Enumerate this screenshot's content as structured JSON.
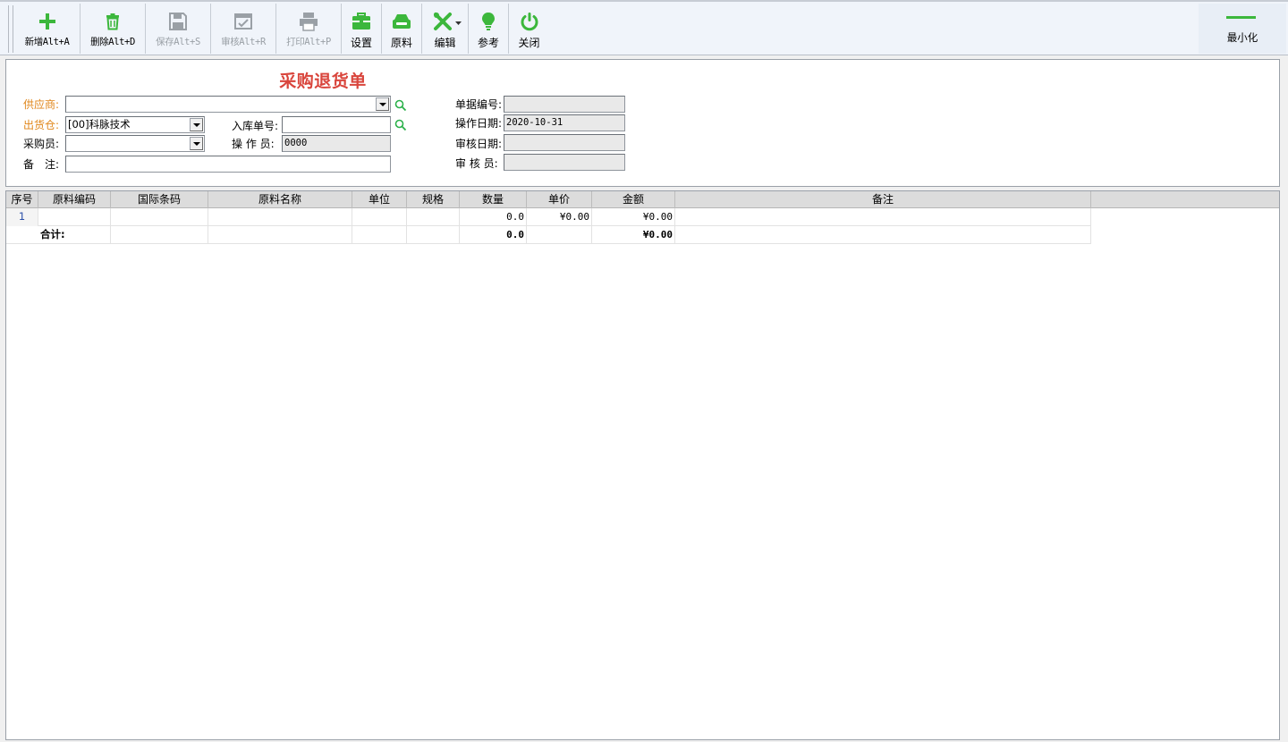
{
  "toolbar": {
    "buttons": [
      {
        "id": "add",
        "label": "新增Alt+A",
        "enabled": true
      },
      {
        "id": "delete",
        "label": "删除Alt+D",
        "enabled": true
      },
      {
        "id": "save",
        "label": "保存Alt+S",
        "enabled": false
      },
      {
        "id": "audit",
        "label": "审核Alt+R",
        "enabled": false
      },
      {
        "id": "print",
        "label": "打印Alt+P",
        "enabled": false
      },
      {
        "id": "settings",
        "label": "设置",
        "enabled": true
      },
      {
        "id": "material",
        "label": "原料",
        "enabled": true
      },
      {
        "id": "edit",
        "label": "编辑",
        "enabled": true
      },
      {
        "id": "reference",
        "label": "参考",
        "enabled": true
      },
      {
        "id": "close",
        "label": "关闭",
        "enabled": true
      }
    ],
    "minimize_label": "最小化"
  },
  "form": {
    "title": "采购退货单",
    "supplier": {
      "label": "供应商:",
      "value": ""
    },
    "warehouse": {
      "label": "出货仓:",
      "value": "[00]科脉技术"
    },
    "buyer": {
      "label": "采购员:",
      "value": ""
    },
    "remark": {
      "label": "备　注:",
      "value": ""
    },
    "stock_in_no": {
      "label": "入库单号:",
      "value": ""
    },
    "operator": {
      "label": "操 作 员:",
      "value": "0000"
    },
    "doc_no": {
      "label": "单据编号:",
      "value": ""
    },
    "op_date": {
      "label": "操作日期:",
      "value": "2020-10-31"
    },
    "audit_date": {
      "label": "审核日期:",
      "value": ""
    },
    "auditor": {
      "label": "审 核 员:",
      "value": ""
    }
  },
  "grid": {
    "columns": [
      "序号",
      "原料编码",
      "国际条码",
      "原料名称",
      "单位",
      "规格",
      "数量",
      "单价",
      "金额",
      "备注"
    ],
    "rows": [
      {
        "seq": "1",
        "code": "",
        "barcode": "",
        "name": "",
        "unit": "",
        "spec": "",
        "qty": "0.0",
        "price": "¥0.00",
        "amount": "¥0.00",
        "remark": ""
      }
    ],
    "total": {
      "label": "合计:",
      "qty": "0.0",
      "amount": "¥0.00"
    }
  },
  "colors": {
    "accent_green": "#3cb73c",
    "title_red": "#d9453c",
    "required_orange": "#e0861a",
    "search_icon_green": "#2bb14a"
  }
}
